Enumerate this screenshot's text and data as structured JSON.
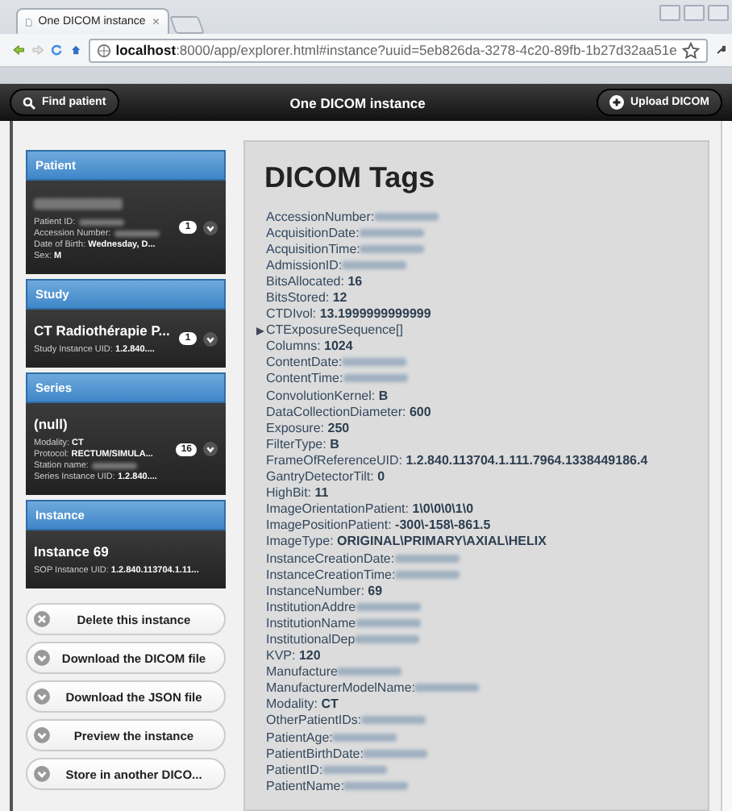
{
  "browser": {
    "tab_title": "One DICOM instance",
    "tab_close": "×",
    "url_host": "localhost",
    "url_rest": ":8000/app/explorer.html#instance?uuid=5eb826da-3278-4c20-89fb-1b27d32aa51e"
  },
  "header": {
    "left_button": "Find patient",
    "title": "One DICOM instance",
    "right_button": "Upload DICOM"
  },
  "sidebar": [
    {
      "heading": "Patient",
      "title_redacted": true,
      "count": "1",
      "fields": [
        {
          "label": "Patient ID:",
          "redacted": true
        },
        {
          "label": "Accession Number:",
          "redacted": true
        },
        {
          "label": "Date of Birth:",
          "value": "Wednesday, D...",
          "redacted": false
        },
        {
          "label": "Sex:",
          "value": "M",
          "redacted": false
        }
      ]
    },
    {
      "heading": "Study",
      "title": "CT Radiothérapie P...",
      "count": "1",
      "fields": [
        {
          "label": "Study Instance UID:",
          "value": "1.2.840....",
          "redacted": false
        }
      ]
    },
    {
      "heading": "Series",
      "title": "(null)",
      "count": "16",
      "fields": [
        {
          "label": "Modality:",
          "value": "CT",
          "redacted": false
        },
        {
          "label": "Protocol:",
          "value": "RECTUM/SIMULA...",
          "redacted": false
        },
        {
          "label": "Station name:",
          "redacted": true
        },
        {
          "label": "Series Instance UID:",
          "value": "1.2.840....",
          "redacted": false
        }
      ]
    },
    {
      "heading": "Instance",
      "title": "Instance 69",
      "fields": [
        {
          "label": "SOP Instance UID:",
          "value": "1.2.840.113704.1.11...",
          "redacted": false
        }
      ]
    }
  ],
  "buttons": [
    {
      "kind": "delete",
      "label": "Delete this instance"
    },
    {
      "kind": "action",
      "label": "Download the DICOM file"
    },
    {
      "kind": "action",
      "label": "Download the JSON file"
    },
    {
      "kind": "action",
      "label": "Preview the instance"
    },
    {
      "kind": "action",
      "label": "Store in another DICO..."
    }
  ],
  "tags_title": "DICOM Tags",
  "tags": [
    {
      "key": "AccessionNumber:",
      "redacted": true
    },
    {
      "key": "AcquisitionDate:",
      "redacted": true
    },
    {
      "key": "AcquisitionTime:",
      "redacted": true
    },
    {
      "key": "AdmissionID:",
      "redacted": true
    },
    {
      "key": "BitsAllocated:",
      "value": "16",
      "redacted": false
    },
    {
      "key": "BitsStored:",
      "value": "12",
      "redacted": false
    },
    {
      "key": "CTDIvol:",
      "value": "13.1999999999999",
      "redacted": false
    },
    {
      "key": "CTExposureSequence[]",
      "redacted": false,
      "expandable": true
    },
    {
      "key": "Columns:",
      "value": "1024",
      "redacted": false
    },
    {
      "key": "ContentDate:",
      "redacted": true
    },
    {
      "key": "ContentTime:",
      "redacted": true
    },
    {
      "key": "ConvolutionKernel:",
      "value": "B",
      "redacted": false
    },
    {
      "key": "DataCollectionDiameter:",
      "value": "600",
      "redacted": false
    },
    {
      "key": "Exposure:",
      "value": "250",
      "redacted": false
    },
    {
      "key": "FilterType:",
      "value": "B",
      "redacted": false
    },
    {
      "key": "FrameOfReferenceUID:",
      "value": "1.2.840.113704.1.111.7964.1338449186.4",
      "redacted": false
    },
    {
      "key": "GantryDetectorTilt:",
      "value": "0",
      "redacted": false
    },
    {
      "key": "HighBit:",
      "value": "11",
      "redacted": false
    },
    {
      "key": "ImageOrientationPatient:",
      "value": "1\\0\\0\\0\\1\\0",
      "redacted": false
    },
    {
      "key": "ImagePositionPatient:",
      "value": "-300\\-158\\-861.5",
      "redacted": false
    },
    {
      "key": "ImageType:",
      "value": "ORIGINAL\\PRIMARY\\AXIAL\\HELIX",
      "redacted": false
    },
    {
      "key": "InstanceCreationDate:",
      "redacted": true
    },
    {
      "key": "InstanceCreationTime:",
      "redacted": true
    },
    {
      "key": "InstanceNumber:",
      "value": "69",
      "redacted": false
    },
    {
      "key": "InstitutionAddre",
      "redacted": true
    },
    {
      "key": "InstitutionName",
      "redacted": true
    },
    {
      "key": "InstitutionalDep",
      "redacted": true
    },
    {
      "key": "KVP:",
      "value": "120",
      "redacted": false
    },
    {
      "key": "Manufacture",
      "redacted": true
    },
    {
      "key": "ManufacturerModelName:",
      "redacted": true
    },
    {
      "key": "Modality:",
      "value": "CT",
      "redacted": false
    },
    {
      "key": "OtherPatientIDs:",
      "redacted": true
    },
    {
      "key": "PatientAge:",
      "redacted": true
    },
    {
      "key": "PatientBirthDate:",
      "redacted": true
    },
    {
      "key": "PatientID:",
      "redacted": true
    },
    {
      "key": "PatientName:",
      "redacted": true
    }
  ]
}
